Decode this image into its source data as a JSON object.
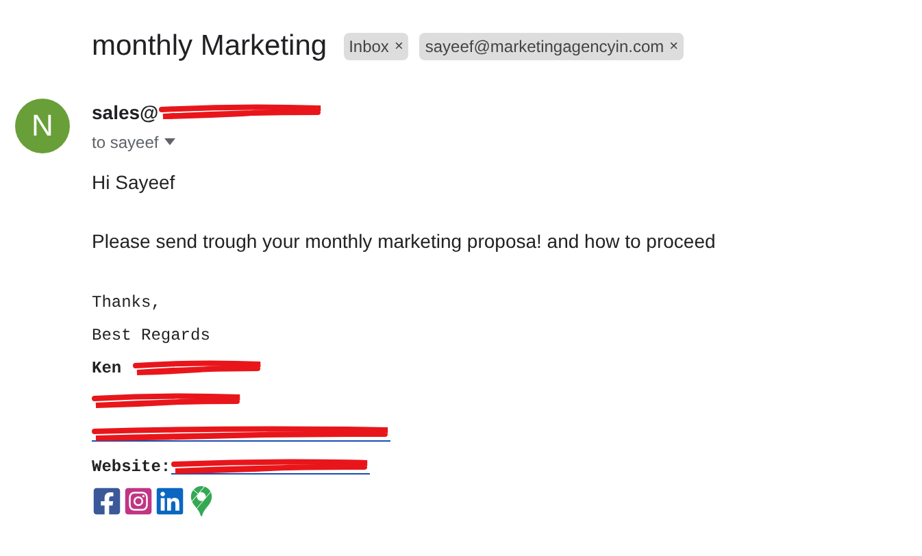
{
  "subject": "monthly Marketing",
  "labels": [
    {
      "text": "Inbox",
      "remove": "×"
    },
    {
      "text": "sayeef@marketingagencyin.com",
      "remove": "×"
    }
  ],
  "sender": {
    "avatar_letter": "N",
    "color": "#689f38",
    "address_visible": "sales@",
    "recipient": "to sayeef"
  },
  "body": [
    "Hi Sayeef",
    "Please send trough your monthly marketing proposa! and how to proceed"
  ],
  "signature": [
    {
      "kind": "text",
      "text": "Thanks,"
    },
    {
      "kind": "text",
      "text": "Best Regards"
    },
    {
      "kind": "redacted_after",
      "text": "Ken"
    },
    {
      "kind": "redacted"
    },
    {
      "kind": "redacted_link"
    },
    {
      "kind": "redacted_link_after",
      "text": "Website:"
    }
  ],
  "social_links": [
    {
      "kind": "facebook"
    },
    {
      "kind": "instagram"
    },
    {
      "kind": "linkedin"
    },
    {
      "kind": "maps"
    }
  ]
}
